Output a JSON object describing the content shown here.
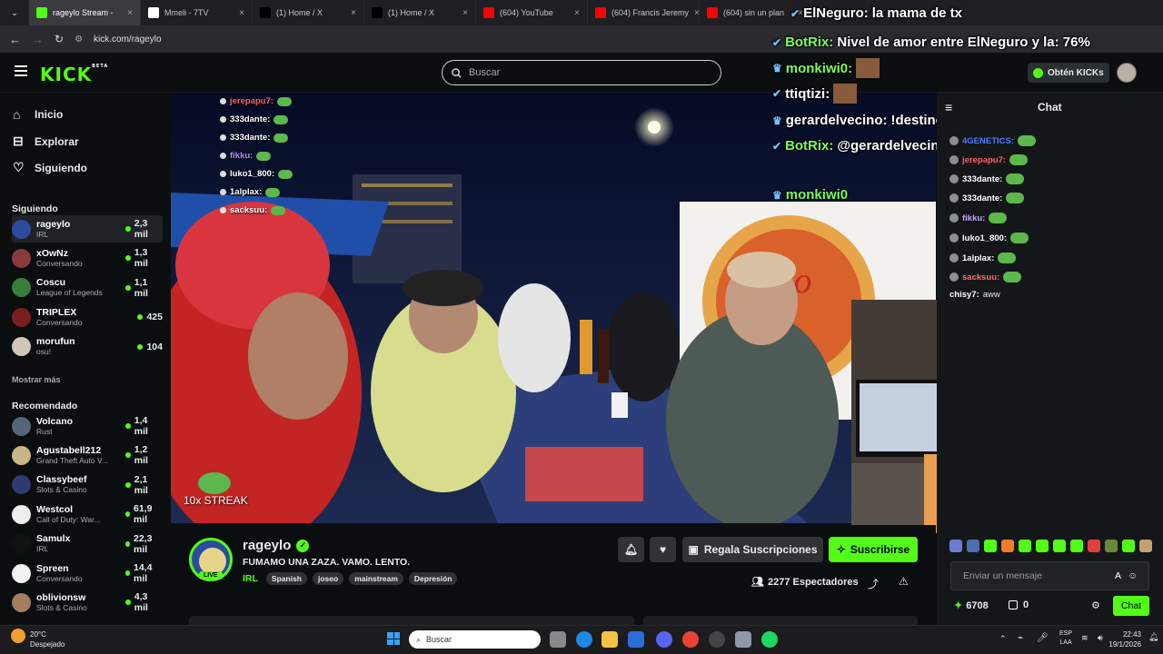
{
  "browser": {
    "tabs": [
      {
        "label": "rageylo Stream -",
        "color": "#53fc18",
        "active": true
      },
      {
        "label": "Mmeli - 7TV",
        "color": "#ffffff",
        "active": false
      },
      {
        "label": "(1) Home / X",
        "color": "#000000",
        "active": false
      },
      {
        "label": "(1) Home / X",
        "color": "#000000",
        "active": false
      },
      {
        "label": "(604) YouTube",
        "color": "#ff0000",
        "active": false
      },
      {
        "label": "(604) Francis Jeremy",
        "color": "#ff0000",
        "active": false
      },
      {
        "label": "(604) sin un plan",
        "color": "#ff0000",
        "active": false
      }
    ],
    "url": "kick.com/rageylo"
  },
  "header": {
    "logo": "KICK",
    "logo_badge": "BETA",
    "search_placeholder": "Buscar",
    "kicks_label": "Obtén KICKs"
  },
  "sidebar": {
    "nav": [
      {
        "label": "Inicio",
        "icon": "home-icon"
      },
      {
        "label": "Explorar",
        "icon": "explore-icon"
      },
      {
        "label": "Siguiendo",
        "icon": "heart-icon"
      }
    ],
    "following_title": "Siguiendo",
    "following": [
      {
        "name": "rageylo",
        "cat": "IRL",
        "viewers": "2,3 mil",
        "color": "#2c4a9e"
      },
      {
        "name": "xOwNz",
        "cat": "Conversando",
        "viewers": "1,3 mil",
        "color": "#8a3b3b"
      },
      {
        "name": "Coscu",
        "cat": "League of Legends",
        "viewers": "1,1 mil",
        "color": "#3a7d3a"
      },
      {
        "name": "TRIPLEX",
        "cat": "Conversando",
        "viewers": "425",
        "color": "#7a1f1f"
      },
      {
        "name": "morufun",
        "cat": "osu!",
        "viewers": "104",
        "color": "#d0c7b8"
      }
    ],
    "show_more": "Mostrar más",
    "recommended_title": "Recomendado",
    "recommended": [
      {
        "name": "Volcano",
        "cat": "Rust",
        "viewers": "1,4 mil",
        "color": "#556677"
      },
      {
        "name": "Agustabell212",
        "cat": "Grand Theft Auto V...",
        "viewers": "1,2 mil",
        "color": "#c9b58a"
      },
      {
        "name": "Classybeef",
        "cat": "Slots & Casino",
        "viewers": "2,1 mil",
        "color": "#2d3b6e"
      },
      {
        "name": "Westcol",
        "cat": "Call of Duty: War...",
        "viewers": "61,9 mil",
        "color": "#eeeeee"
      },
      {
        "name": "Samulx",
        "cat": "IRL",
        "viewers": "22,3 mil",
        "color": "#111111"
      },
      {
        "name": "Spreen",
        "cat": "Conversando",
        "viewers": "14,4 mil",
        "color": "#f2f2f2"
      },
      {
        "name": "oblivionsw",
        "cat": "Slots & Casino",
        "viewers": "4,3 mil",
        "color": "#a47c5e"
      }
    ]
  },
  "overlay_chat": [
    {
      "user": "jerepapu7:",
      "color": "#ff5f5f"
    },
    {
      "user": "333dante:",
      "color": "#ffffff"
    },
    {
      "user": "333dante:",
      "color": "#ffffff"
    },
    {
      "user": "fikku:",
      "color": "#b88cff"
    },
    {
      "user": "luko1_800:",
      "color": "#ffffff"
    },
    {
      "user": "1alplax:",
      "color": "#ffffff"
    },
    {
      "user": "sacksuu:",
      "color": "#ffffff"
    }
  ],
  "streak_text": "10x STREAK",
  "big_overlay": [
    {
      "user": "ElNeguro:",
      "text": "la mama de tx",
      "color": "#ffffff"
    },
    {
      "user": "BotRix:",
      "text": "Nivel de amor entre ElNeguro y la: 76%",
      "color": "#7cfc5c"
    },
    {
      "user": "monkiwi0:",
      "text": "",
      "color": "#7cfc5c"
    },
    {
      "user": "ttiqtizi:",
      "text": "",
      "color": "#ffffff"
    },
    {
      "user": "gerardelvecino:",
      "text": "!destino",
      "color": "#ffffff"
    },
    {
      "user": "BotRix:",
      "text": "@gerardelvecino el destino dice que seras mod",
      "color": "#7cfc5c"
    },
    {
      "user": "monkiwi0",
      "text": "",
      "color": "#7cfc5c"
    }
  ],
  "chat": {
    "title": "Chat",
    "messages": [
      {
        "user": "4GENETICS:",
        "text": "",
        "color": "#4b7bff"
      },
      {
        "user": "jerepapu7:",
        "text": "",
        "color": "#ff5f5f"
      },
      {
        "user": "333dante:",
        "text": "",
        "color": "#ffffff"
      },
      {
        "user": "333dante:",
        "text": "",
        "color": "#ffffff"
      },
      {
        "user": "fikku:",
        "text": "",
        "color": "#c6a4ff"
      },
      {
        "user": "luko1_800:",
        "text": "",
        "color": "#ffffff"
      },
      {
        "user": "1alplax:",
        "text": "",
        "color": "#ffffff"
      },
      {
        "user": "sacksuu:",
        "text": "",
        "color": "#ff6b6b"
      },
      {
        "user": "chisy7:",
        "text": "aww",
        "color": "#ffffff"
      }
    ],
    "input_placeholder": "Enviar un mensaje",
    "points": "6708",
    "kicks": "0",
    "send_label": "Chat"
  },
  "stream": {
    "name": "rageylo",
    "title": "FUMAMO UNA ZAZA. VAMO. LENTO.",
    "category": "IRL",
    "tags": [
      "Spanish",
      "joseo",
      "mainstream",
      "Depresión"
    ],
    "live_badge": "LIVE",
    "gift_label": "Regala Suscripciones",
    "sub_label": "Suscribirse",
    "viewers": "2277 Espectadores"
  },
  "taskbar": {
    "weather_temp": "20°C",
    "weather_desc": "Despejado",
    "search": "Buscar",
    "lang1": "ESP",
    "lang2": "LAA",
    "time": "22:43",
    "date": "19/1/2026"
  }
}
